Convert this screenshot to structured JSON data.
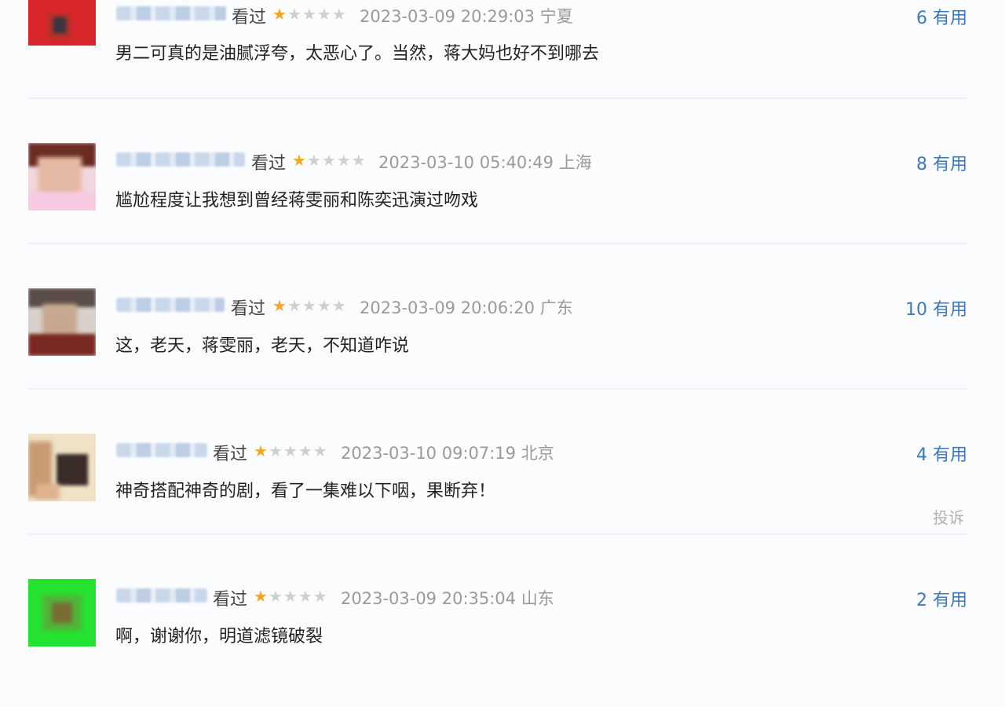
{
  "comments": [
    {
      "seen_label": "看过",
      "rating": 1,
      "max_rating": 5,
      "datetime": "2023-03-09 20:29:03",
      "location": "宁夏",
      "text": "男二可真的是油腻浮夸，太恶心了。当然，蒋大妈也好不到哪去",
      "useful_count": "6",
      "useful_label": "有用"
    },
    {
      "seen_label": "看过",
      "rating": 1,
      "max_rating": 5,
      "datetime": "2023-03-10 05:40:49",
      "location": "上海",
      "text": "尴尬程度让我想到曾经蒋雯丽和陈奕迅演过吻戏",
      "useful_count": "8",
      "useful_label": "有用"
    },
    {
      "seen_label": "看过",
      "rating": 1,
      "max_rating": 5,
      "datetime": "2023-03-09 20:06:20",
      "location": "广东",
      "text": "这，老天，蒋雯丽，老天，不知道咋说",
      "useful_count": "10",
      "useful_label": "有用"
    },
    {
      "seen_label": "看过",
      "rating": 1,
      "max_rating": 5,
      "datetime": "2023-03-10 09:07:19",
      "location": "北京",
      "text": "神奇搭配神奇的剧，看了一集难以下咽，果断弃！",
      "useful_count": "4",
      "useful_label": "有用",
      "report_label": "投诉"
    },
    {
      "seen_label": "看过",
      "rating": 1,
      "max_rating": 5,
      "datetime": "2023-03-09 20:35:04",
      "location": "山东",
      "text": "啊，谢谢你，明道滤镜破裂",
      "useful_count": "2",
      "useful_label": "有用"
    }
  ],
  "colors": {
    "star_on": "#f4a623",
    "star_off": "#cfcfcf",
    "useful": "#3e78b8",
    "time": "#9a9a9a"
  },
  "icons": {
    "star": "star-icon"
  }
}
